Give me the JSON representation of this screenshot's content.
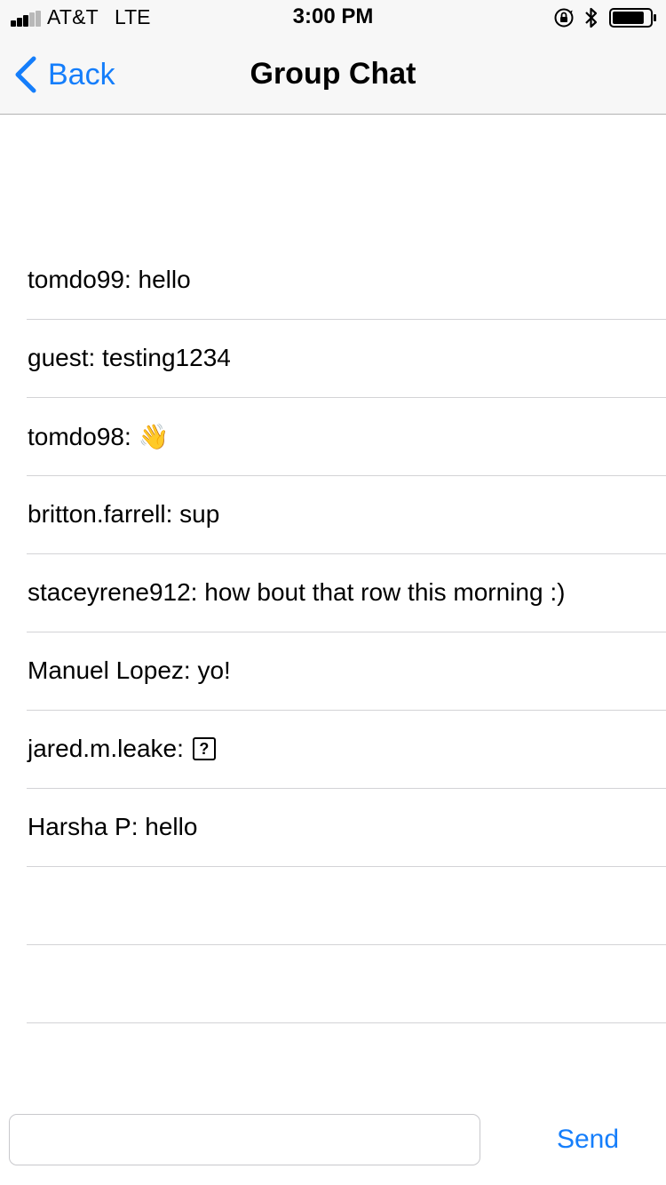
{
  "status_bar": {
    "carrier": "AT&T",
    "network": "LTE",
    "time": "3:00 PM",
    "signal_bars_filled": 3,
    "signal_bars_total": 5,
    "battery_level": 0.85,
    "icons": [
      "signal-icon",
      "orientation-lock-icon",
      "bluetooth-icon",
      "battery-icon"
    ]
  },
  "nav": {
    "back_label": "Back",
    "title": "Group Chat"
  },
  "messages": [
    {
      "text": "tomdo99: hello"
    },
    {
      "text": "guest: testing1234"
    },
    {
      "text": "tomdo98:",
      "glyph": "👋"
    },
    {
      "text": "britton.farrell: sup"
    },
    {
      "text": "staceyrene912: how bout that row this morning :)"
    },
    {
      "text": "Manuel Lopez: yo!"
    },
    {
      "text": "jared.m.leake:",
      "glyph": "?"
    },
    {
      "text": "Harsha P: hello"
    },
    {
      "text": ""
    },
    {
      "text": ""
    }
  ],
  "composer": {
    "input_value": "",
    "input_placeholder": "",
    "send_label": "Send"
  },
  "colors": {
    "accent": "#157efb",
    "bar_background": "#f7f7f7",
    "separator": "#d3d3d6"
  }
}
